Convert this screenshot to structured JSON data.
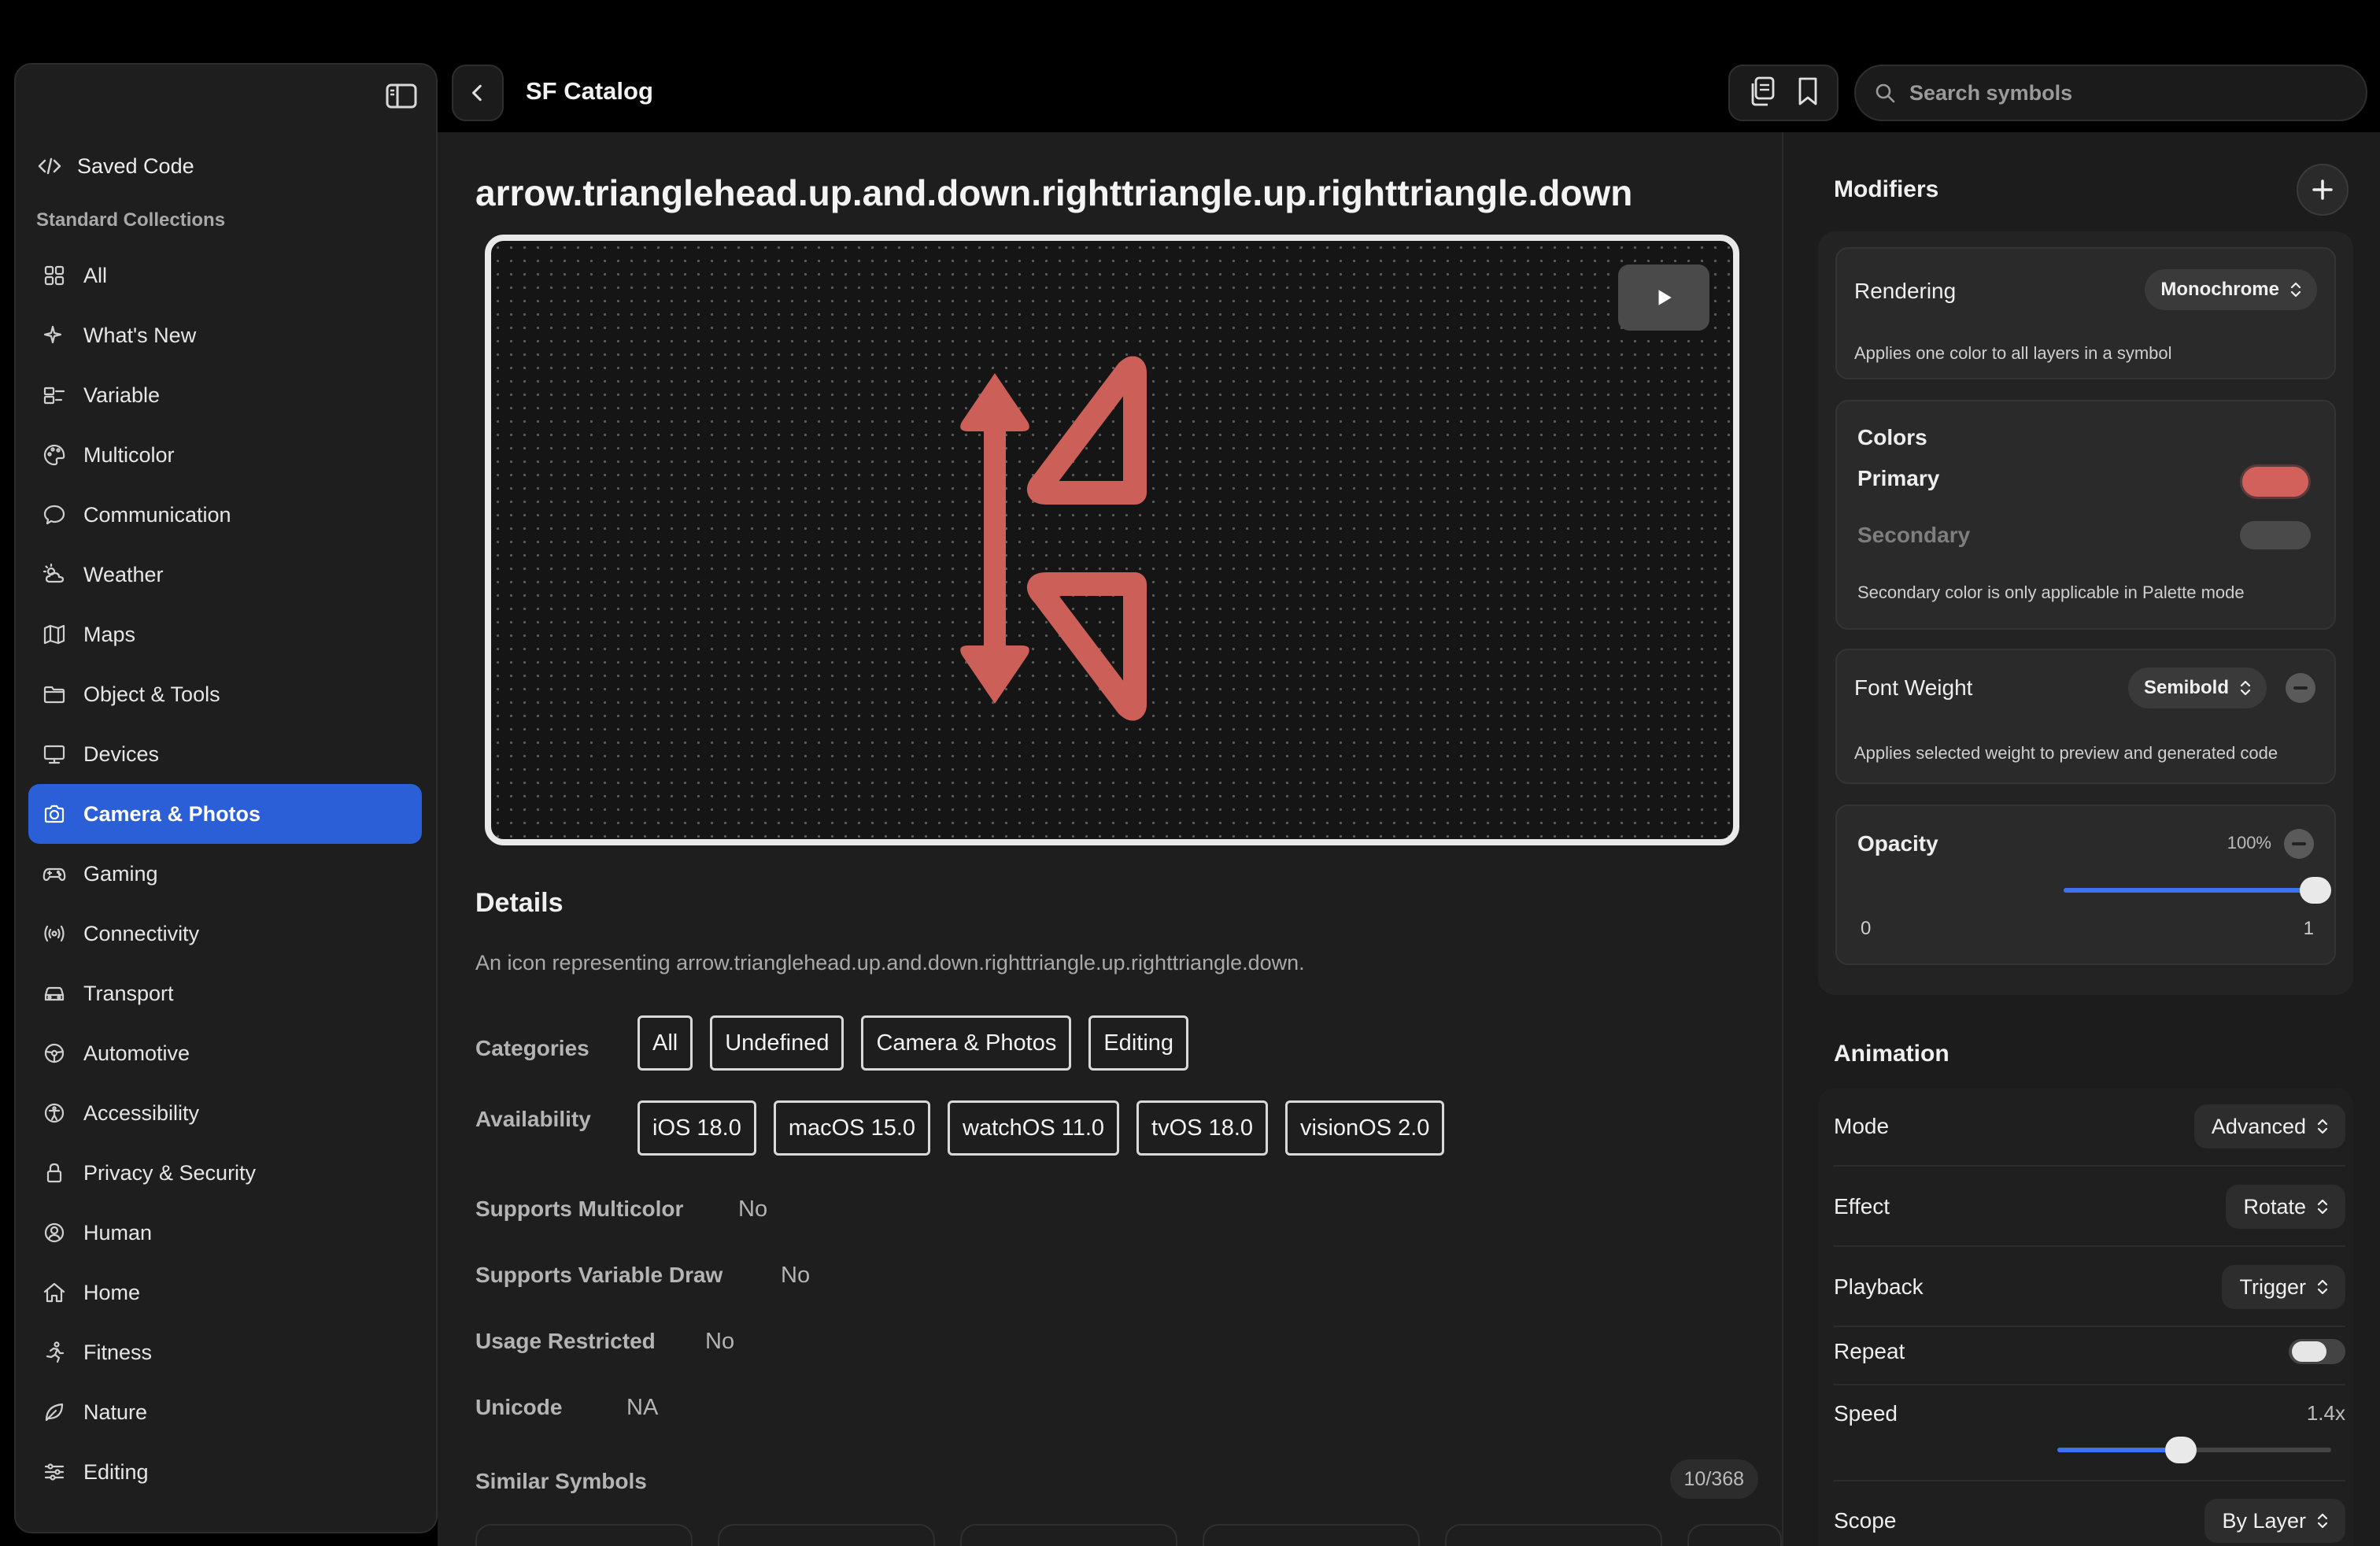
{
  "app": {
    "title": "SF Catalog"
  },
  "search": {
    "placeholder": "Search symbols"
  },
  "sidebar": {
    "saved_code": "Saved Code",
    "section_title": "Standard Collections",
    "items": [
      {
        "label": "All",
        "icon": "grid-icon",
        "active": false
      },
      {
        "label": "What's New",
        "icon": "sparkles-icon",
        "active": false
      },
      {
        "label": "Variable",
        "icon": "variable-icon",
        "active": false
      },
      {
        "label": "Multicolor",
        "icon": "palette-icon",
        "active": false
      },
      {
        "label": "Communication",
        "icon": "message-bubble-icon",
        "active": false
      },
      {
        "label": "Weather",
        "icon": "sun-cloud-icon",
        "active": false
      },
      {
        "label": "Maps",
        "icon": "map-icon",
        "active": false
      },
      {
        "label": "Object & Tools",
        "icon": "folder-icon",
        "active": false
      },
      {
        "label": "Devices",
        "icon": "display-icon",
        "active": false
      },
      {
        "label": "Camera & Photos",
        "icon": "camera-icon",
        "active": true
      },
      {
        "label": "Gaming",
        "icon": "gamecontroller-icon",
        "active": false
      },
      {
        "label": "Connectivity",
        "icon": "antenna-icon",
        "active": false
      },
      {
        "label": "Transport",
        "icon": "car-icon",
        "active": false
      },
      {
        "label": "Automotive",
        "icon": "steering-wheel-icon",
        "active": false
      },
      {
        "label": "Accessibility",
        "icon": "accessibility-icon",
        "active": false
      },
      {
        "label": "Privacy & Security",
        "icon": "lock-icon",
        "active": false
      },
      {
        "label": "Human",
        "icon": "person-circle-icon",
        "active": false
      },
      {
        "label": "Home",
        "icon": "house-icon",
        "active": false
      },
      {
        "label": "Fitness",
        "icon": "figure-run-icon",
        "active": false
      },
      {
        "label": "Nature",
        "icon": "leaf-icon",
        "active": false
      },
      {
        "label": "Editing",
        "icon": "sliders-icon",
        "active": false
      }
    ]
  },
  "symbol": {
    "name": "arrow.trianglehead.up.and.down.righttriangle.up.righttriangle.down",
    "color": "#cd5f59"
  },
  "details": {
    "heading": "Details",
    "description": "An icon representing arrow.trianglehead.up.and.down.righttriangle.up.righttriangle.down.",
    "categories_label": "Categories",
    "categories": [
      "All",
      "Undefined",
      "Camera & Photos",
      "Editing"
    ],
    "availability_label": "Availability",
    "availability": [
      "iOS 18.0",
      "macOS 15.0",
      "watchOS 11.0",
      "tvOS 18.0",
      "visionOS 2.0"
    ],
    "supports_multicolor_label": "Supports Multicolor",
    "supports_multicolor": "No",
    "supports_variable_draw_label": "Supports Variable Draw",
    "supports_variable_draw": "No",
    "usage_restricted_label": "Usage Restricted",
    "usage_restricted": "No",
    "unicode_label": "Unicode",
    "unicode": "NA",
    "similar_label": "Similar Symbols",
    "similar_count": "10/368"
  },
  "modifiers": {
    "heading": "Modifiers",
    "rendering_label": "Rendering",
    "rendering_value": "Monochrome",
    "rendering_note": "Applies one color to all layers in a symbol",
    "colors_label": "Colors",
    "primary_label": "Primary",
    "primary_color": "#d2615b",
    "secondary_label": "Secondary",
    "secondary_color": "#4a4a4a",
    "colors_note": "Secondary color is only applicable in Palette mode",
    "font_weight_label": "Font Weight",
    "font_weight_value": "Semibold",
    "font_weight_note": "Applies selected weight to preview and generated code",
    "opacity_label": "Opacity",
    "opacity_value": "100%",
    "opacity_fraction": 1.0,
    "opacity_min": "0",
    "opacity_max": "1"
  },
  "animation": {
    "heading": "Animation",
    "mode_label": "Mode",
    "mode_value": "Advanced",
    "effect_label": "Effect",
    "effect_value": "Rotate",
    "playback_label": "Playback",
    "playback_value": "Trigger",
    "repeat_label": "Repeat",
    "repeat_on": false,
    "speed_label": "Speed",
    "speed_value": "1.4x",
    "speed_fraction": 0.45,
    "scope_label": "Scope",
    "scope_value": "By Layer"
  },
  "colors": {
    "accent": "#2a5fd8",
    "slider": "#3b73f0"
  }
}
